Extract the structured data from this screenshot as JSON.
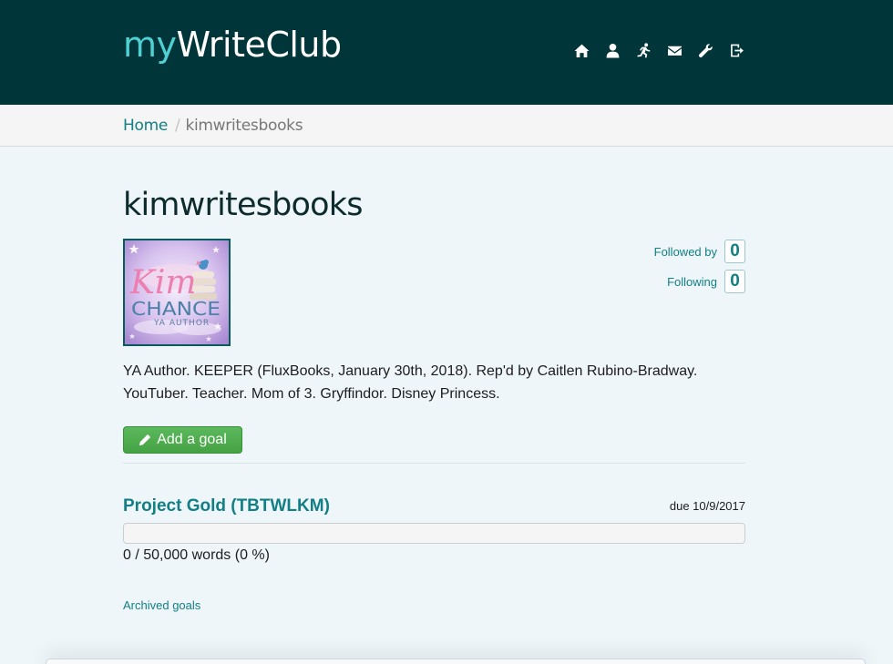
{
  "brand": {
    "my": "my",
    "rest": "WriteClub"
  },
  "nav": {
    "icons": [
      "home-icon",
      "user-icon",
      "running-icon",
      "mail-icon",
      "wrench-icon",
      "sign-out-icon"
    ]
  },
  "breadcrumb": {
    "home": "Home",
    "separator": "/",
    "current": "kimwritesbooks"
  },
  "profile": {
    "title": "kimwritesbooks",
    "avatar_text": {
      "name": "Kim",
      "surname": "CHANCE",
      "tagline": "YA AUTHOR"
    },
    "followed_by_label": "Followed by",
    "followed_by_count": "0",
    "following_label": "Following",
    "following_count": "0",
    "bio_line1": "YA Author. KEEPER (FluxBooks, January 30th, 2018). Rep'd by Caitlen Rubino-Bradway.",
    "bio_line2": "YouTuber. Teacher. Mom of 3. Gryffindor. Disney Princess."
  },
  "actions": {
    "add_goal": "Add a goal"
  },
  "goal": {
    "title": "Project Gold (TBTWLKM)",
    "due": "due 10/9/2017",
    "progress_fraction": 0,
    "stats": "0 / 50,000 words (0 %)"
  },
  "archived_link": "Archived goals",
  "colors": {
    "header_bg": "#00363a",
    "brand_accent": "#4fd0d3",
    "link": "#117f84",
    "button_green": "#5cb85c",
    "page_bg": "#eef6fa"
  }
}
